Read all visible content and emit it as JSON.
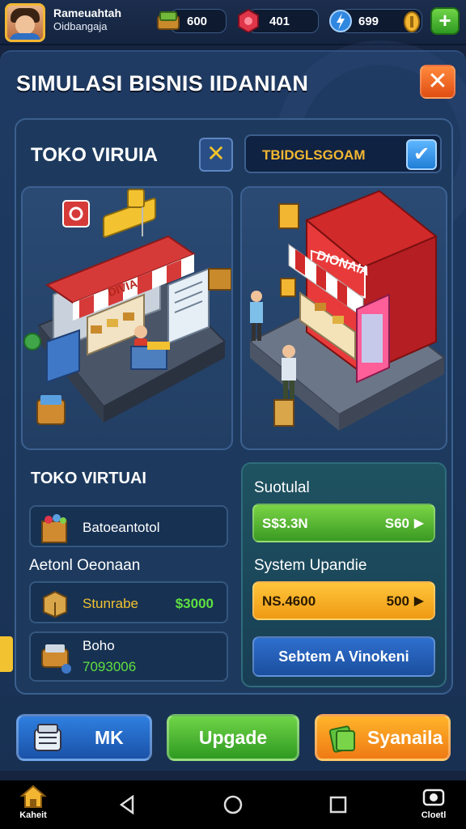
{
  "player": {
    "name": "Rameuahtah",
    "subtitle": "Oidbangaja"
  },
  "resources": [
    {
      "icon": "cash-stack-icon",
      "value": "600"
    },
    {
      "icon": "gem-icon",
      "value": "401"
    },
    {
      "icon": "energy-icon",
      "value": "699"
    }
  ],
  "title": "SIMULASI BISNIS IIDANIAN",
  "store": {
    "title": "TOKO VIRUIA",
    "code": "TBIDGLSGOAM",
    "left_sign": "DIVIA",
    "right_sign": "DIONAIA"
  },
  "left_section": {
    "title": "TOKO VIRTUAI",
    "item1_label": "Batoeantotol",
    "subtitle": "Aetonl Oeonaan",
    "item2_label": "Stunrabe",
    "item2_value": "$3000",
    "item3_label": "Boho",
    "item3_value": "7093006"
  },
  "right_section": {
    "title1": "Suotulal",
    "green_left": "S$3.3N",
    "green_right": "S60",
    "title2": "System Upandie",
    "orange_left": "NS.4600",
    "orange_right": "500",
    "blue_label": "Sebtem A Vinokeni"
  },
  "bottom_buttons": {
    "left": "MK",
    "middle": "Upgade",
    "right": "Syanaila"
  },
  "nav": {
    "home": "Kaheit",
    "right": "Cloetl"
  },
  "colors": {
    "accent_orange": "#e8601c",
    "green": "#3da52a",
    "gold": "#f2b632",
    "panel": "#1d3a5e"
  }
}
